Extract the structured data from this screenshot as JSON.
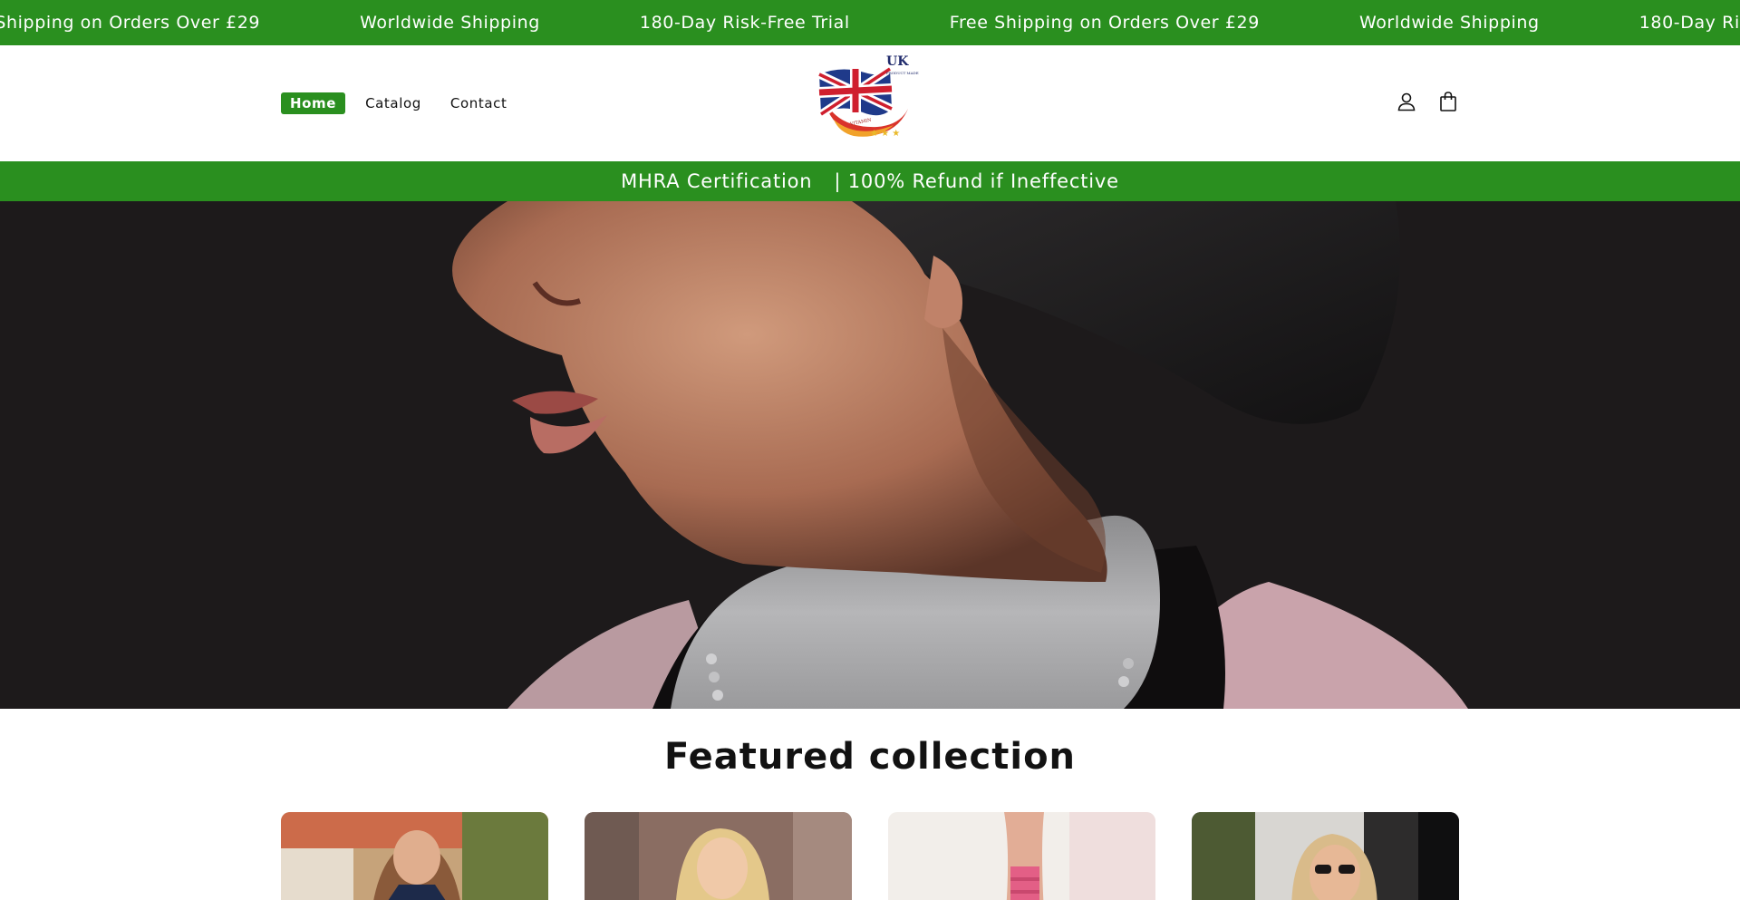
{
  "announcement": {
    "items": [
      "Free Shipping on Orders Over £29",
      "Worldwide Shipping",
      "180-Day Risk-Free Trial",
      "Free Shipping on Orders Over £29",
      "Worldwide Shipping",
      "180-Day Risk-Free Trial"
    ],
    "background": "#2a8f1f"
  },
  "header": {
    "nav": [
      {
        "label": "Home",
        "active": true
      },
      {
        "label": "Catalog",
        "active": false
      },
      {
        "label": "Contact",
        "active": false
      }
    ],
    "logo": {
      "text_top": "UK",
      "text_sub": "PRODUCT MADE",
      "text_arc": "VITAMIN"
    },
    "icons": [
      "account-icon",
      "cart-icon"
    ]
  },
  "cert_bar": {
    "left": "MHRA Certification",
    "right": "| 100% Refund if Ineffective"
  },
  "hero": {
    "image": "hero-portrait-image"
  },
  "featured": {
    "title": "Featured collection",
    "products": [
      "product-1-image",
      "product-2-image",
      "product-3-image",
      "product-4-image"
    ]
  },
  "colors": {
    "accent": "#2a8f1f",
    "text": "#121212",
    "hero_bg": "#1d1a1b"
  }
}
